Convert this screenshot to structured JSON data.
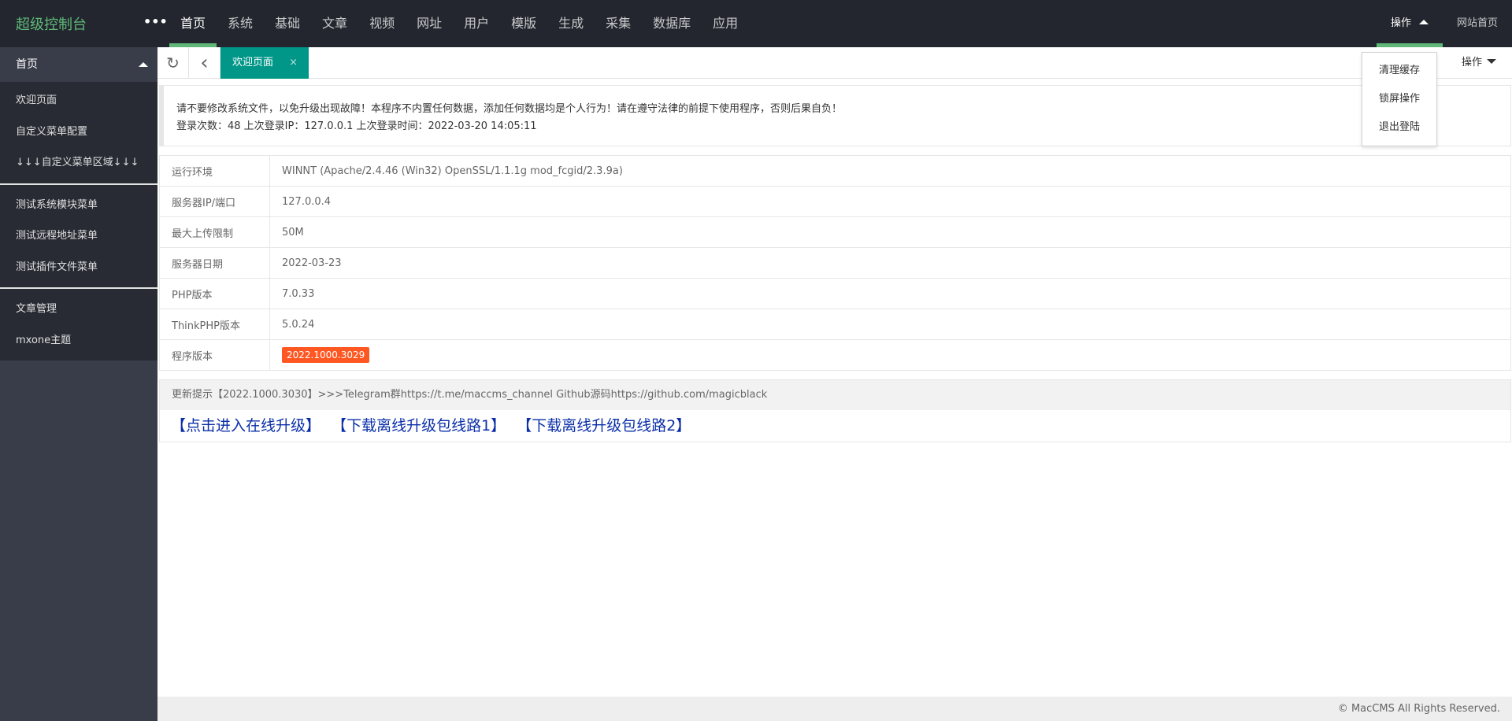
{
  "header": {
    "logo": "超级控制台",
    "more": "•••",
    "nav": [
      "首页",
      "系统",
      "基础",
      "文章",
      "视频",
      "网址",
      "用户",
      "模版",
      "生成",
      "采集",
      "数据库",
      "应用"
    ],
    "operate": "操作",
    "site_home": "网站首页"
  },
  "dropdown": [
    "清理缓存",
    "锁屏操作",
    "退出登陆"
  ],
  "sidebar": {
    "head": "首页",
    "groups": [
      [
        "欢迎页面",
        "自定义菜单配置",
        "↓↓↓自定义菜单区域↓↓↓"
      ],
      [
        "测试系统模块菜单",
        "测试远程地址菜单",
        "测试插件文件菜单"
      ],
      [
        "文章管理",
        "mxone主题"
      ]
    ]
  },
  "tabbar": {
    "tab": "欢迎页面",
    "close": "×",
    "operate": "操作",
    "refresh": "↻",
    "back": "‹"
  },
  "notice": {
    "line1": "请不要修改系统文件，以免升级出现故障！本程序不内置任何数据，添加任何数据均是个人行为！请在遵守法律的前提下使用程序，否则后果自负！",
    "line2": "登录次数：48 上次登录IP：127.0.0.1 上次登录时间：2022-03-20 14:05:11"
  },
  "info": [
    {
      "label": "运行环境",
      "value": "WINNT (Apache/2.4.46 (Win32) OpenSSL/1.1.1g mod_fcgid/2.3.9a)"
    },
    {
      "label": "服务器IP/端口",
      "value": "127.0.0.4"
    },
    {
      "label": "最大上传限制",
      "value": "50M"
    },
    {
      "label": "服务器日期",
      "value": "2022-03-23"
    },
    {
      "label": "PHP版本",
      "value": "7.0.33"
    },
    {
      "label": "ThinkPHP版本",
      "value": "5.0.24"
    },
    {
      "label": "程序版本",
      "value": "2022.1000.3029"
    }
  ],
  "update": {
    "tip": "更新提示【2022.1000.3030】>>>Telegram群https://t.me/maccms_channel   Github源码https://github.com/magicblack",
    "links": [
      "【点击进入在线升级】",
      "【下载离线升级包线路1】",
      "【下载离线升级包线路2】"
    ]
  },
  "footer": "© MacCMS All Rights Reserved."
}
